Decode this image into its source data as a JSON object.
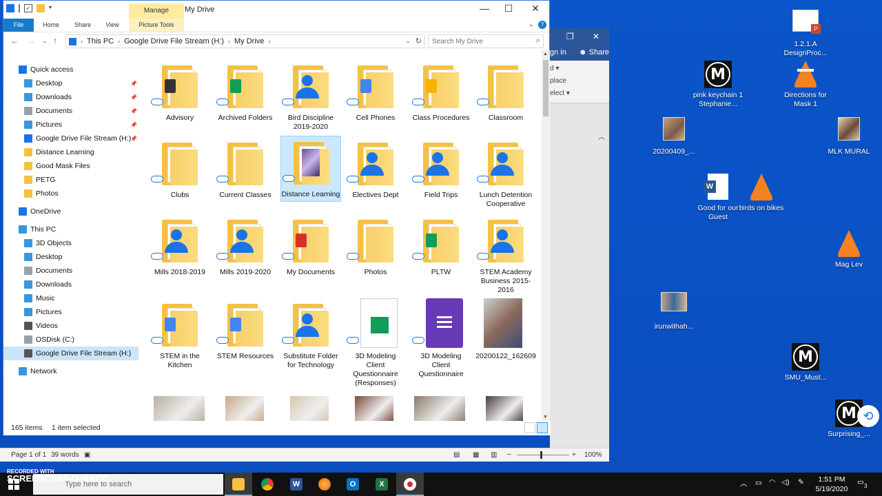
{
  "explorer": {
    "title": "My Drive",
    "manage_label": "Manage",
    "tabs": [
      "File",
      "Home",
      "Share",
      "View",
      "Picture Tools"
    ],
    "breadcrumb": [
      "This PC",
      "Google Drive File Stream (H:)",
      "My Drive"
    ],
    "search_placeholder": "Search My Drive",
    "status": {
      "items": "165 items",
      "selected": "1 item selected"
    }
  },
  "nav": {
    "quick_access": "Quick access",
    "quick_items": [
      "Desktop",
      "Downloads",
      "Documents",
      "Pictures",
      "Google Drive File Stream (H:)",
      "Distance Learning",
      "Good Mask Files",
      "PETG",
      "Photos"
    ],
    "onedrive": "OneDrive",
    "this_pc": "This PC",
    "pc_items": [
      "3D Objects",
      "Desktop",
      "Documents",
      "Downloads",
      "Music",
      "Pictures",
      "Videos",
      "OSDisk (C:)",
      "Google Drive File Stream (H:)"
    ],
    "network": "Network"
  },
  "files": [
    {
      "label": "Advisory",
      "kind": "folder-badge",
      "badge_color": "#333333"
    },
    {
      "label": "Archived Folders",
      "kind": "folder-badge",
      "badge_color": "#0f9d58"
    },
    {
      "label": "Bird Discipline 2019-2020",
      "kind": "folder-shared"
    },
    {
      "label": "Cell Phones",
      "kind": "folder-badge",
      "badge_color": "#4285f4"
    },
    {
      "label": "Class Procedures",
      "kind": "folder-badge",
      "badge_color": "#f4b400"
    },
    {
      "label": "Classroom",
      "kind": "folder"
    },
    {
      "label": "Clubs",
      "kind": "folder"
    },
    {
      "label": "Current Classes",
      "kind": "folder"
    },
    {
      "label": "Distance Learning",
      "kind": "folder-selected"
    },
    {
      "label": "Electives Dept",
      "kind": "folder-shared"
    },
    {
      "label": "Field Trips",
      "kind": "folder-shared"
    },
    {
      "label": "Lunch Detention Cooperative",
      "kind": "folder-shared"
    },
    {
      "label": "Mills 2018-2019",
      "kind": "folder-shared"
    },
    {
      "label": "Mills 2019-2020",
      "kind": "folder-shared"
    },
    {
      "label": "My Documents",
      "kind": "folder-badge",
      "badge_color": "#d93025"
    },
    {
      "label": "Photos",
      "kind": "folder"
    },
    {
      "label": "PLTW",
      "kind": "folder-badge",
      "badge_color": "#0f9d58"
    },
    {
      "label": "STEM Academy Business 2015-2016",
      "kind": "folder-shared"
    },
    {
      "label": "STEM in the Kitchen",
      "kind": "folder-badge",
      "badge_color": "#4285f4"
    },
    {
      "label": "STEM Resources",
      "kind": "folder-badge",
      "badge_color": "#4285f4"
    },
    {
      "label": "Substitute Folder for Technology",
      "kind": "folder-shared"
    },
    {
      "label": "3D Modeling Client Questionnaire (Responses)",
      "kind": "sheet"
    },
    {
      "label": "3D Modeling Client Questionnaire",
      "kind": "form"
    },
    {
      "label": "20200122_162609",
      "kind": "photo"
    }
  ],
  "desktop_icons": [
    {
      "label": "1.2.1.A DesignProc...",
      "kind": "ppt"
    },
    {
      "label": "pink keychain 1 Stephanie...",
      "kind": "mb"
    },
    {
      "label": "Directions for Mask 1",
      "kind": "vlc"
    },
    {
      "label": "20200409_...",
      "kind": "pic"
    },
    {
      "label": "MLK MURAL",
      "kind": "pic"
    },
    {
      "label": "Good for our Guest",
      "kind": "word"
    },
    {
      "label": "birds on bikes",
      "kind": "vlc"
    },
    {
      "label": "Mag Lev",
      "kind": "vlc"
    },
    {
      "label": "irunwithah...",
      "kind": "pic"
    },
    {
      "label": "SMU_Must...",
      "kind": "mb"
    },
    {
      "label": "Surprising_...",
      "kind": "mb"
    }
  ],
  "word": {
    "signin": "gn in",
    "share": "Share",
    "status_page": "Page 1 of 1",
    "status_words": "39 words",
    "zoom": "100%",
    "ribbon_frag": [
      "d ▾",
      "place",
      "elect ▾"
    ]
  },
  "taskbar": {
    "search": "Type here to search",
    "time": "1:51 PM",
    "date": "5/19/2020",
    "notif_count": "3"
  },
  "watermark": {
    "line1": "RECORDED WITH",
    "line2": "SCREENCAST-O-MATIC"
  }
}
